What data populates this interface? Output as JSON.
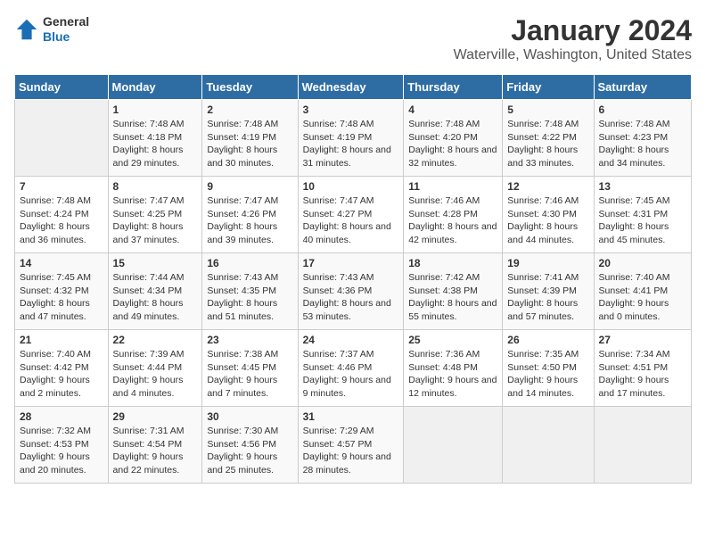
{
  "header": {
    "logo_general": "General",
    "logo_blue": "Blue",
    "title": "January 2024",
    "subtitle": "Waterville, Washington, United States"
  },
  "days_of_week": [
    "Sunday",
    "Monday",
    "Tuesday",
    "Wednesday",
    "Thursday",
    "Friday",
    "Saturday"
  ],
  "weeks": [
    [
      {
        "day": "",
        "sunrise": "",
        "sunset": "",
        "daylight": ""
      },
      {
        "day": "1",
        "sunrise": "Sunrise: 7:48 AM",
        "sunset": "Sunset: 4:18 PM",
        "daylight": "Daylight: 8 hours and 29 minutes."
      },
      {
        "day": "2",
        "sunrise": "Sunrise: 7:48 AM",
        "sunset": "Sunset: 4:19 PM",
        "daylight": "Daylight: 8 hours and 30 minutes."
      },
      {
        "day": "3",
        "sunrise": "Sunrise: 7:48 AM",
        "sunset": "Sunset: 4:19 PM",
        "daylight": "Daylight: 8 hours and 31 minutes."
      },
      {
        "day": "4",
        "sunrise": "Sunrise: 7:48 AM",
        "sunset": "Sunset: 4:20 PM",
        "daylight": "Daylight: 8 hours and 32 minutes."
      },
      {
        "day": "5",
        "sunrise": "Sunrise: 7:48 AM",
        "sunset": "Sunset: 4:22 PM",
        "daylight": "Daylight: 8 hours and 33 minutes."
      },
      {
        "day": "6",
        "sunrise": "Sunrise: 7:48 AM",
        "sunset": "Sunset: 4:23 PM",
        "daylight": "Daylight: 8 hours and 34 minutes."
      }
    ],
    [
      {
        "day": "7",
        "sunrise": "Sunrise: 7:48 AM",
        "sunset": "Sunset: 4:24 PM",
        "daylight": "Daylight: 8 hours and 36 minutes."
      },
      {
        "day": "8",
        "sunrise": "Sunrise: 7:47 AM",
        "sunset": "Sunset: 4:25 PM",
        "daylight": "Daylight: 8 hours and 37 minutes."
      },
      {
        "day": "9",
        "sunrise": "Sunrise: 7:47 AM",
        "sunset": "Sunset: 4:26 PM",
        "daylight": "Daylight: 8 hours and 39 minutes."
      },
      {
        "day": "10",
        "sunrise": "Sunrise: 7:47 AM",
        "sunset": "Sunset: 4:27 PM",
        "daylight": "Daylight: 8 hours and 40 minutes."
      },
      {
        "day": "11",
        "sunrise": "Sunrise: 7:46 AM",
        "sunset": "Sunset: 4:28 PM",
        "daylight": "Daylight: 8 hours and 42 minutes."
      },
      {
        "day": "12",
        "sunrise": "Sunrise: 7:46 AM",
        "sunset": "Sunset: 4:30 PM",
        "daylight": "Daylight: 8 hours and 44 minutes."
      },
      {
        "day": "13",
        "sunrise": "Sunrise: 7:45 AM",
        "sunset": "Sunset: 4:31 PM",
        "daylight": "Daylight: 8 hours and 45 minutes."
      }
    ],
    [
      {
        "day": "14",
        "sunrise": "Sunrise: 7:45 AM",
        "sunset": "Sunset: 4:32 PM",
        "daylight": "Daylight: 8 hours and 47 minutes."
      },
      {
        "day": "15",
        "sunrise": "Sunrise: 7:44 AM",
        "sunset": "Sunset: 4:34 PM",
        "daylight": "Daylight: 8 hours and 49 minutes."
      },
      {
        "day": "16",
        "sunrise": "Sunrise: 7:43 AM",
        "sunset": "Sunset: 4:35 PM",
        "daylight": "Daylight: 8 hours and 51 minutes."
      },
      {
        "day": "17",
        "sunrise": "Sunrise: 7:43 AM",
        "sunset": "Sunset: 4:36 PM",
        "daylight": "Daylight: 8 hours and 53 minutes."
      },
      {
        "day": "18",
        "sunrise": "Sunrise: 7:42 AM",
        "sunset": "Sunset: 4:38 PM",
        "daylight": "Daylight: 8 hours and 55 minutes."
      },
      {
        "day": "19",
        "sunrise": "Sunrise: 7:41 AM",
        "sunset": "Sunset: 4:39 PM",
        "daylight": "Daylight: 8 hours and 57 minutes."
      },
      {
        "day": "20",
        "sunrise": "Sunrise: 7:40 AM",
        "sunset": "Sunset: 4:41 PM",
        "daylight": "Daylight: 9 hours and 0 minutes."
      }
    ],
    [
      {
        "day": "21",
        "sunrise": "Sunrise: 7:40 AM",
        "sunset": "Sunset: 4:42 PM",
        "daylight": "Daylight: 9 hours and 2 minutes."
      },
      {
        "day": "22",
        "sunrise": "Sunrise: 7:39 AM",
        "sunset": "Sunset: 4:44 PM",
        "daylight": "Daylight: 9 hours and 4 minutes."
      },
      {
        "day": "23",
        "sunrise": "Sunrise: 7:38 AM",
        "sunset": "Sunset: 4:45 PM",
        "daylight": "Daylight: 9 hours and 7 minutes."
      },
      {
        "day": "24",
        "sunrise": "Sunrise: 7:37 AM",
        "sunset": "Sunset: 4:46 PM",
        "daylight": "Daylight: 9 hours and 9 minutes."
      },
      {
        "day": "25",
        "sunrise": "Sunrise: 7:36 AM",
        "sunset": "Sunset: 4:48 PM",
        "daylight": "Daylight: 9 hours and 12 minutes."
      },
      {
        "day": "26",
        "sunrise": "Sunrise: 7:35 AM",
        "sunset": "Sunset: 4:50 PM",
        "daylight": "Daylight: 9 hours and 14 minutes."
      },
      {
        "day": "27",
        "sunrise": "Sunrise: 7:34 AM",
        "sunset": "Sunset: 4:51 PM",
        "daylight": "Daylight: 9 hours and 17 minutes."
      }
    ],
    [
      {
        "day": "28",
        "sunrise": "Sunrise: 7:32 AM",
        "sunset": "Sunset: 4:53 PM",
        "daylight": "Daylight: 9 hours and 20 minutes."
      },
      {
        "day": "29",
        "sunrise": "Sunrise: 7:31 AM",
        "sunset": "Sunset: 4:54 PM",
        "daylight": "Daylight: 9 hours and 22 minutes."
      },
      {
        "day": "30",
        "sunrise": "Sunrise: 7:30 AM",
        "sunset": "Sunset: 4:56 PM",
        "daylight": "Daylight: 9 hours and 25 minutes."
      },
      {
        "day": "31",
        "sunrise": "Sunrise: 7:29 AM",
        "sunset": "Sunset: 4:57 PM",
        "daylight": "Daylight: 9 hours and 28 minutes."
      },
      {
        "day": "",
        "sunrise": "",
        "sunset": "",
        "daylight": ""
      },
      {
        "day": "",
        "sunrise": "",
        "sunset": "",
        "daylight": ""
      },
      {
        "day": "",
        "sunrise": "",
        "sunset": "",
        "daylight": ""
      }
    ]
  ]
}
